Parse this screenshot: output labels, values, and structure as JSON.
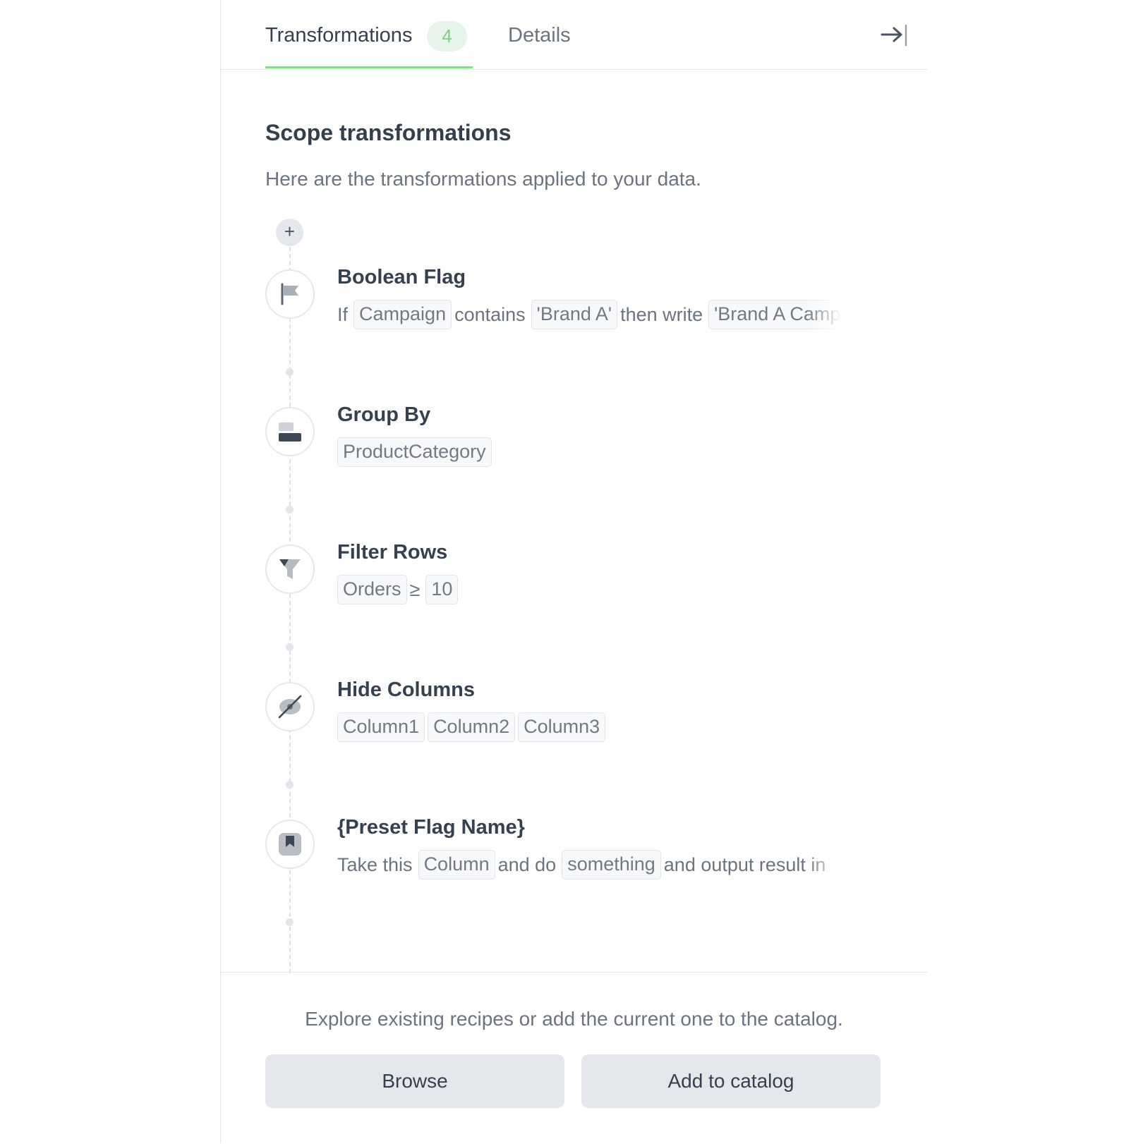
{
  "tabs": {
    "transformations": {
      "label": "Transformations",
      "count": "4"
    },
    "details": {
      "label": "Details"
    }
  },
  "section": {
    "title": "Scope transformations",
    "subtitle": "Here are the transformations applied to your data."
  },
  "add_button": {
    "label": "+"
  },
  "steps": [
    {
      "icon": "flag-icon",
      "title": "Boolean Flag",
      "parts": [
        "If",
        "Campaign",
        "contains",
        "'Brand A'",
        "then write",
        "'Brand A Campaign'"
      ]
    },
    {
      "icon": "group-by-icon",
      "title": "Group By",
      "parts": [
        "ProductCategory"
      ]
    },
    {
      "icon": "filter-icon",
      "title": "Filter Rows",
      "parts": [
        "Orders",
        "≥",
        "10"
      ]
    },
    {
      "icon": "eye-off-icon",
      "title": "Hide Columns",
      "parts": [
        "Column1",
        "Column2",
        "Column3"
      ]
    },
    {
      "icon": "bookmark-icon",
      "title": "{Preset Flag Name}",
      "parts": [
        "Take this",
        "Column",
        "and do",
        "something",
        "and output result in"
      ]
    }
  ],
  "footer": {
    "text": "Explore existing recipes or add the current one to the catalog.",
    "browse_label": "Browse",
    "add_label": "Add to catalog"
  },
  "colors": {
    "accent_green": "#86d98f",
    "badge_bg": "#e7f4e9",
    "button_bg": "#e4e7eb",
    "text_dark": "#364150",
    "text_muted": "#6b7480"
  }
}
